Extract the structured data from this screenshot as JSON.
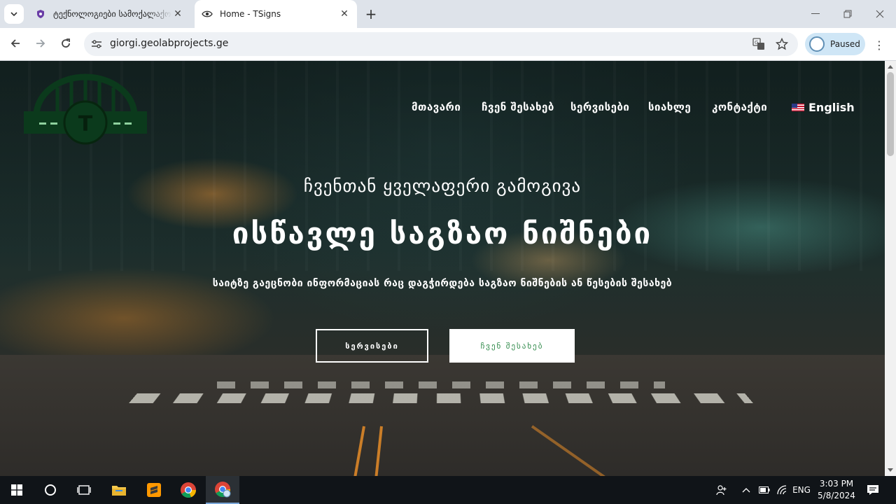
{
  "browser": {
    "tabs": [
      {
        "title": "ტექნოლოგიები სამოქალაქო",
        "active": false
      },
      {
        "title": "Home - TSigns",
        "active": true
      }
    ],
    "url": "giorgi.geolabprojects.ge",
    "profile_label": "Paused"
  },
  "site": {
    "logo_letter": "T",
    "nav": [
      {
        "label": "მთავარი"
      },
      {
        "label": "ჩვენ შესახებ"
      },
      {
        "label": "სერვისები"
      },
      {
        "label": "სიახლე"
      },
      {
        "label": "კონტაქტი"
      }
    ],
    "language": "English",
    "hero": {
      "subtitle": "ჩვენთან ყველაფერი გამოგივა",
      "title": "ისწავლე საგზაო ნიშნები",
      "description": "საიტზე გაეცნობი ინფორმაციას რაც დაგჭირდება საგზაო ნიშნების ან წესების შესახებ",
      "button_services": "სერვისები",
      "button_about": "ჩვენ შესახებ"
    },
    "colors": {
      "accent_green": "#2f8a4a",
      "logo_green": "#0b3a1c"
    }
  },
  "taskbar": {
    "language": "ENG",
    "time": "3:03 PM",
    "date": "5/8/2024"
  }
}
